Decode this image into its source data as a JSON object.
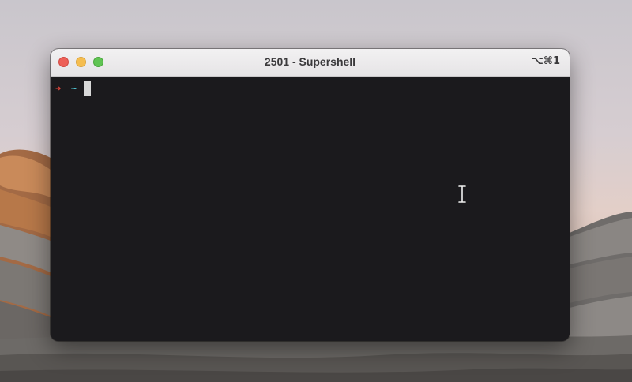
{
  "window": {
    "title": "2501 - Supershell",
    "shortcut": "⌥⌘1",
    "buttons": [
      "close",
      "minimize",
      "zoom"
    ]
  },
  "terminal": {
    "prompt_symbol": "➜",
    "cwd": "~",
    "input": "",
    "colors": {
      "background": "#1b1a1d",
      "prompt_arrow": "#e0453b",
      "cwd": "#4fc2cf",
      "cursor": "#d8d8d8"
    }
  },
  "pointer": {
    "icon": "ibeam-cursor-icon"
  }
}
